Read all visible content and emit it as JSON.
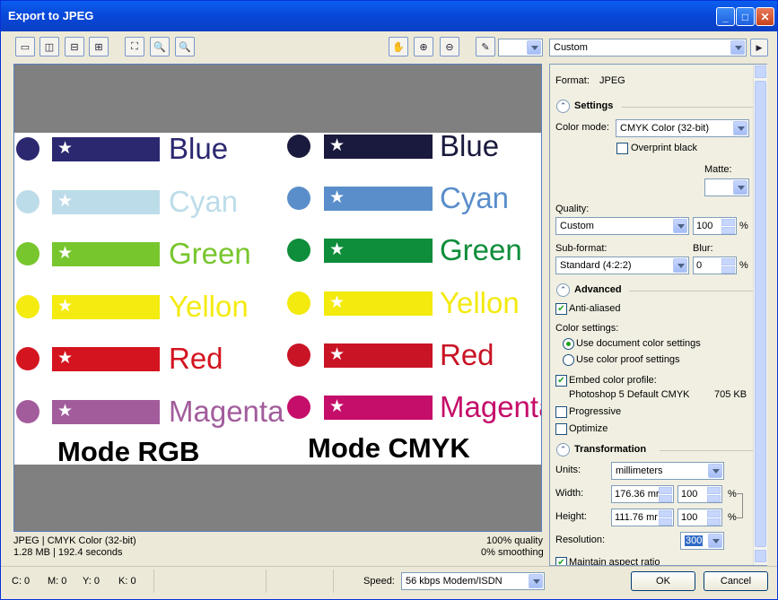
{
  "window": {
    "title": "Export to JPEG",
    "min": "_",
    "max": "□",
    "close": "✕"
  },
  "toolbar": {
    "preset": "Custom",
    "color_picker_value": "",
    "next": "▶"
  },
  "preview": {
    "rgb": [
      {
        "label": "Blue",
        "color": "#2b2870"
      },
      {
        "label": "Cyan",
        "color": "#bddce9"
      },
      {
        "label": "Green",
        "color": "#78c62e"
      },
      {
        "label": "Yellon",
        "color": "#f4eb10"
      },
      {
        "label": "Red",
        "color": "#d4141f"
      },
      {
        "label": "Magenta",
        "color": "#a25c9c"
      }
    ],
    "cmyk": [
      {
        "label": "Blue",
        "color": "#1a1a3e"
      },
      {
        "label": "Cyan",
        "color": "#5a8ecb"
      },
      {
        "label": "Green",
        "color": "#0e8d3a"
      },
      {
        "label": "Yellon",
        "color": "#f3ea0e"
      },
      {
        "label": "Red",
        "color": "#c91425"
      },
      {
        "label": "Magenta",
        "color": "#c50d6a"
      }
    ],
    "mode_rgb": "Mode  RGB",
    "mode_cmyk": "Mode  CMYK"
  },
  "status": {
    "format": "JPEG  |  CMYK Color (32-bit)",
    "size": "1.28 MB  |  192.4 seconds",
    "quality": "100% quality",
    "smoothing": "0% smoothing"
  },
  "panel": {
    "format_label": "Format:",
    "format_value": "JPEG",
    "settings": "Settings",
    "color_mode_label": "Color mode:",
    "color_mode_value": "CMYK Color (32-bit)",
    "overprint_black": "Overprint black",
    "matte_label": "Matte:",
    "quality_label": "Quality:",
    "quality_value": "Custom",
    "quality_num": "100",
    "pct": "%",
    "subformat_label": "Sub-format:",
    "subformat_value": "Standard (4:2:2)",
    "blur_label": "Blur:",
    "blur_value": "0",
    "advanced": "Advanced",
    "anti_aliased": "Anti-aliased",
    "color_settings": "Color settings:",
    "use_doc": "Use document color settings",
    "use_proof": "Use color proof settings",
    "embed_profile": "Embed color profile:",
    "profile_name": "Photoshop 5 Default CMYK",
    "profile_size": "705 KB",
    "progressive": "Progressive",
    "optimize": "Optimize",
    "transformation": "Transformation",
    "units_label": "Units:",
    "units_value": "millimeters",
    "width_label": "Width:",
    "width_value": "176.36 mr",
    "width_pct": "100",
    "height_label": "Height:",
    "height_value": "111.76 mr",
    "height_pct": "100",
    "resolution_label": "Resolution:",
    "resolution_value": "300",
    "maintain": "Maintain aspect ratio"
  },
  "bottom": {
    "c": "C: 0",
    "m": "M: 0",
    "y": "Y: 0",
    "k": "K: 0",
    "speed_label": "Speed:",
    "speed_value": "56 kbps Modem/ISDN",
    "ok": "OK",
    "cancel": "Cancel"
  }
}
